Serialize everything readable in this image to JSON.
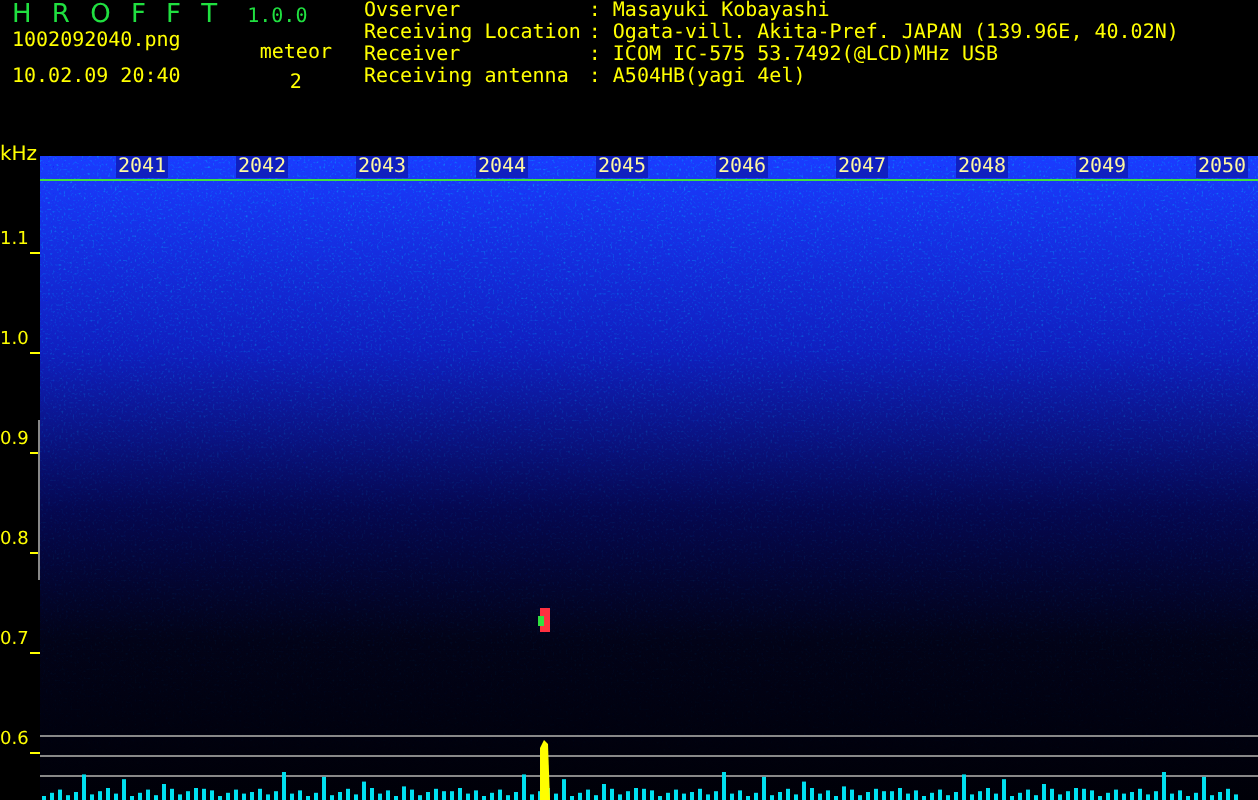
{
  "app": {
    "title": "H R O F F T",
    "version": "1.0.0"
  },
  "file": {
    "name": "1002092040.png",
    "datetime": "10.02.09 20:40"
  },
  "meteor": {
    "label": "meteor",
    "count": "2"
  },
  "info": [
    {
      "label": "Ovserver",
      "value": ": Masayuki Kobayashi"
    },
    {
      "label": "Receiving Location",
      "value": ": Ogata-vill. Akita-Pref. JAPAN (139.96E, 40.02N)"
    },
    {
      "label": "Receiver",
      "value": ": ICOM IC-575 53.7492(@LCD)MHz USB"
    },
    {
      "label": "Receiving antenna",
      "value": ": A504HB(yagi 4el)"
    }
  ],
  "axis": {
    "unit": "kHz",
    "frequency_labels": [
      "1.1",
      "1.0",
      "0.9",
      "0.8",
      "0.7",
      "0.6"
    ],
    "time_labels": [
      "2041",
      "2042",
      "2043",
      "2044",
      "2045",
      "2046",
      "2047",
      "2048",
      "2049",
      "2050"
    ]
  }
}
